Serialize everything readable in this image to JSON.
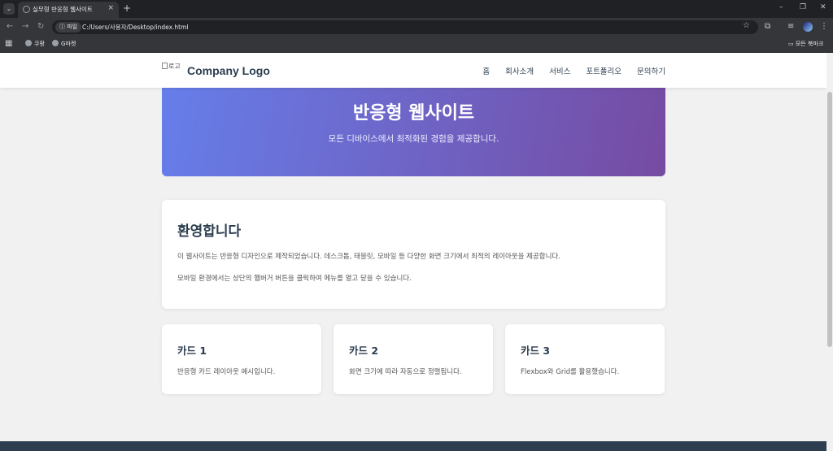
{
  "browser": {
    "tab_title": "실무형 반응형 웹사이트",
    "tab_close": "×",
    "new_tab": "+",
    "tab_menu": "⌄",
    "minimize": "–",
    "restore": "❐",
    "close": "✕",
    "site_info": "ⓘ 파일",
    "url": "C:/Users/사용자/Desktop/index.html",
    "back": "←",
    "forward": "→",
    "reload": "↻",
    "star": "☆",
    "bookmarks": [
      "쿠팡",
      "G마켓"
    ],
    "all_bookmarks": "모든 북마크"
  },
  "site": {
    "logo_alt": "로고",
    "logo_text": "Company Logo",
    "nav": [
      "홈",
      "회사소개",
      "서비스",
      "포트폴리오",
      "문의하기"
    ],
    "hero": {
      "title": "반응형 웹사이트",
      "subtitle": "모든 디바이스에서 최적화된 경험을 제공합니다."
    },
    "welcome": {
      "title": "환영합니다",
      "paragraphs": [
        "이 웹사이트는 반응형 디자인으로 제작되었습니다. 데스크톱, 태블릿, 모바일 등 다양한 화면 크기에서 최적의 레이아웃을 제공합니다.",
        "모바일 환경에서는 상단의 햄버거 버튼을 클릭하여 메뉴를 열고 닫을 수 있습니다."
      ]
    },
    "cards": [
      {
        "title": "카드 1",
        "text": "반응형 카드 레이아웃 예시입니다."
      },
      {
        "title": "카드 2",
        "text": "화면 크기에 따라 자동으로 정렬됩니다."
      },
      {
        "title": "카드 3",
        "text": "Flexbox와 Grid를 활용했습니다."
      }
    ]
  },
  "colors": {
    "hero_gradient_start": "#667eea",
    "hero_gradient_end": "#764ba2",
    "heading": "#2c3e50",
    "footer": "#2c3e50"
  }
}
